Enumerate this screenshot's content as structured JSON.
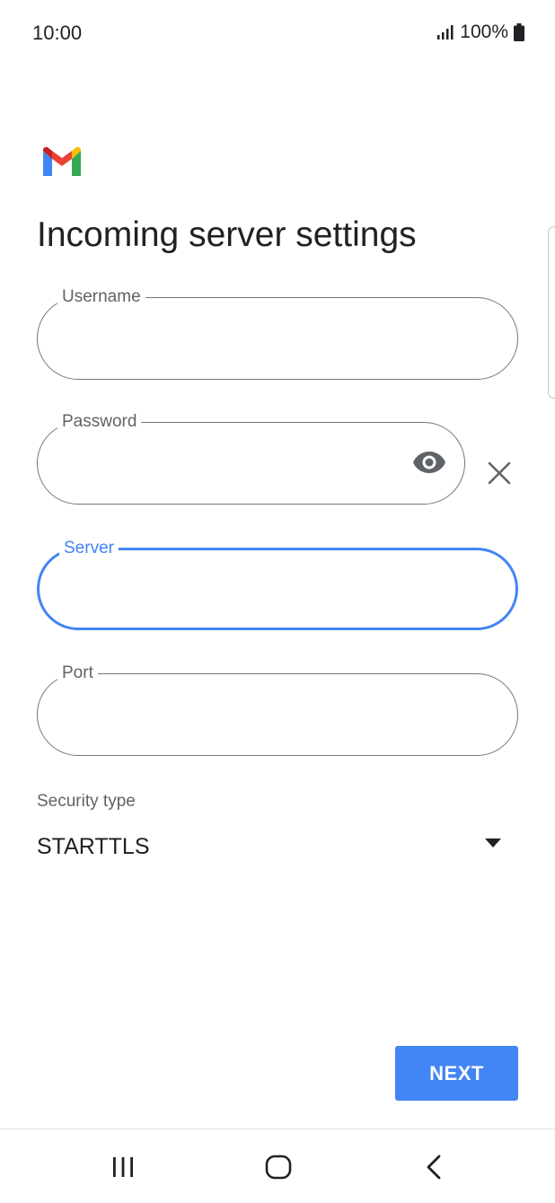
{
  "status_bar": {
    "time": "10:00",
    "battery": "100%",
    "icons": [
      "signal-icon",
      "battery-icon"
    ]
  },
  "app": {
    "logo": "gmail-logo",
    "title": "Incoming server settings"
  },
  "form": {
    "username": {
      "label": "Username",
      "value": ""
    },
    "password": {
      "label": "Password",
      "value": "",
      "icons": [
        "eye-icon",
        "close-icon"
      ]
    },
    "server": {
      "label": "Server",
      "value": "",
      "focused": true
    },
    "port": {
      "label": "Port",
      "value": ""
    },
    "security_type": {
      "label": "Security type",
      "value": "STARTTLS",
      "icon": "dropdown-arrow-icon"
    }
  },
  "actions": {
    "next_label": "NEXT"
  },
  "navigation": {
    "items": [
      "recents-icon",
      "home-icon",
      "back-icon"
    ]
  },
  "colors": {
    "accent": "#4285f4",
    "field_border": "#757575",
    "label": "#5f6368",
    "text": "#202124"
  }
}
